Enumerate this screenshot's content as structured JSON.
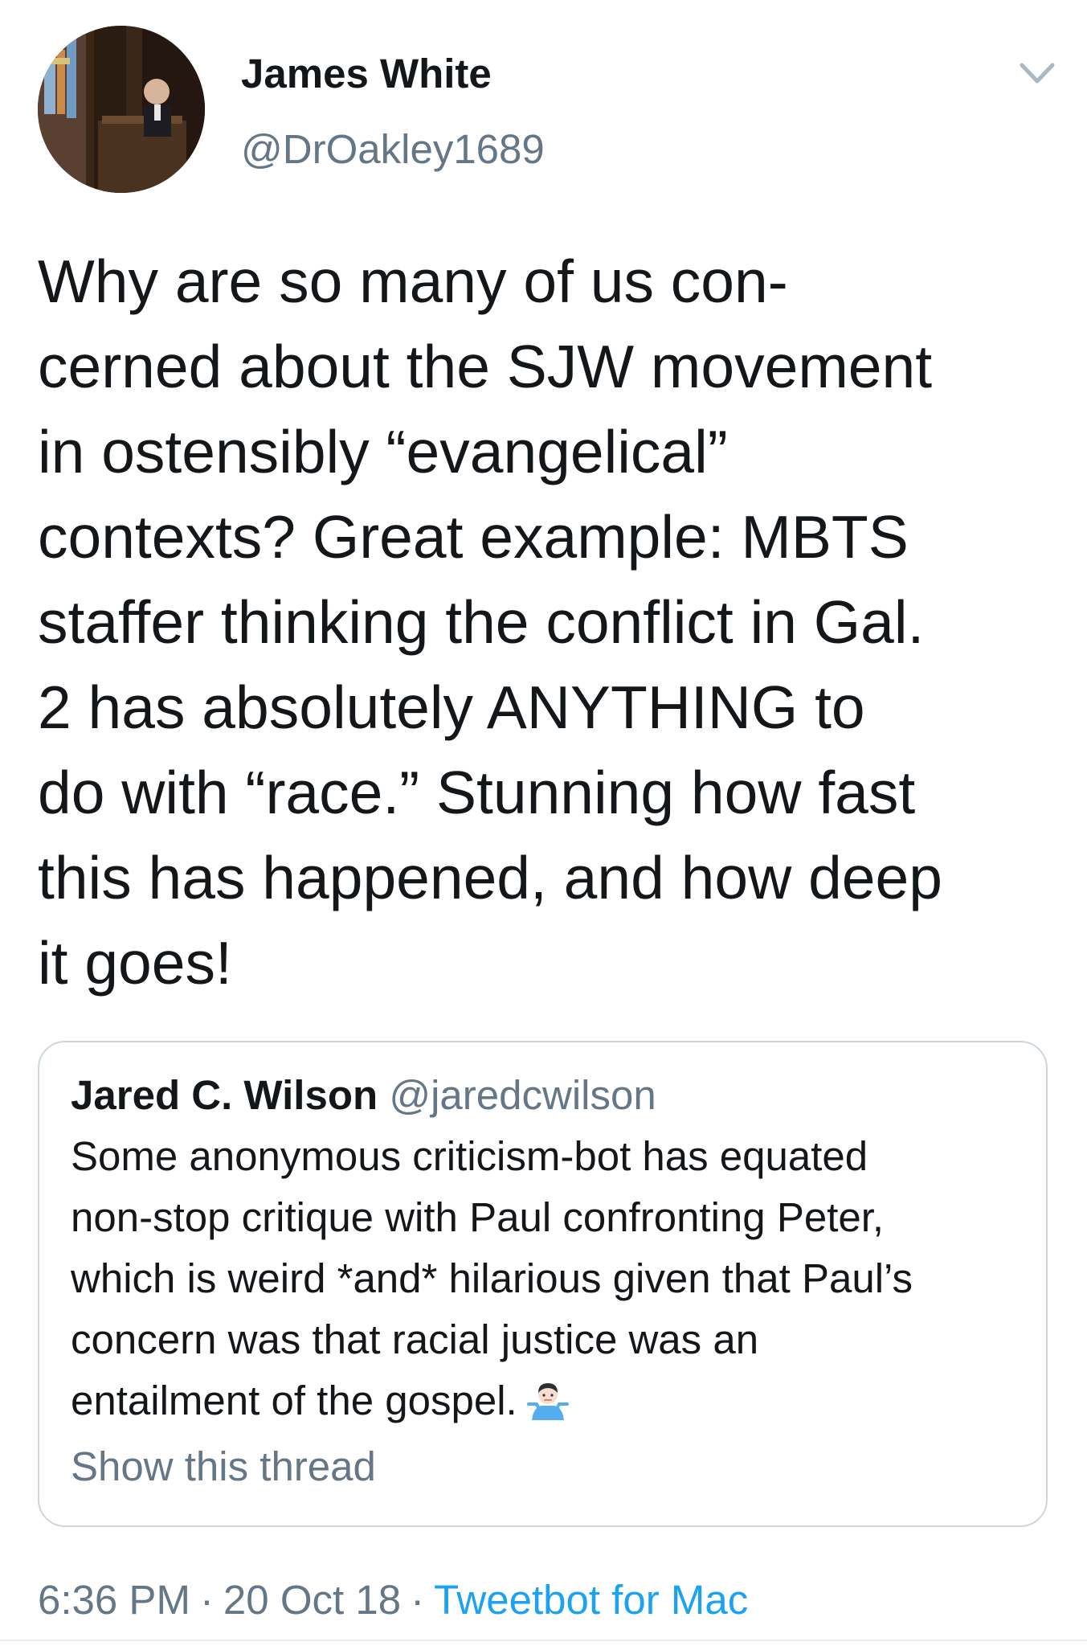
{
  "tweet": {
    "author": {
      "name": "James White",
      "handle": "@DrOakley1689"
    },
    "text_lines": [
      "Why are so many of us con-",
      "cerned about the SJW movement",
      "in ostensibly “evangelical”",
      "contexts? Great example: MBTS",
      "staffer thinking the conflict in Gal.",
      "2 has absolutely ANYTHING to",
      "do with “race.” Stunning how fast",
      "this has happened, and how deep",
      "it goes!"
    ],
    "quoted": {
      "name": "Jared C. Wilson",
      "handle": "@jaredcwilson",
      "text_lines": [
        "Some anonymous criticism-bot has equated",
        "non-stop critique with Paul confronting Peter,",
        "which is weird *and* hilarious given that Paul’s",
        "concern was that racial justice was an",
        "entailment of the gospel."
      ],
      "emoji": "person-shrugging-icon",
      "show_thread": "Show this thread"
    },
    "time": "6:36 PM",
    "date": "20 Oct 18",
    "separator": "·",
    "source": "Tweetbot for Mac"
  },
  "colors": {
    "text": "#14171a",
    "secondary": "#657786",
    "link": "#1da1f2",
    "border": "#ccd6dd"
  }
}
